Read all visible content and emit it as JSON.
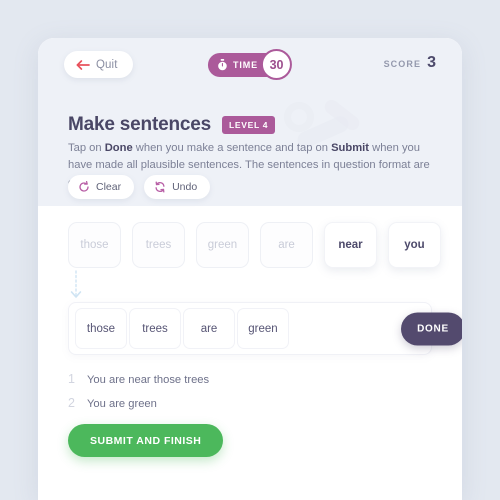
{
  "topbar": {
    "quit_label": "Quit",
    "quit_icon": "arrow-left-icon",
    "time_label": "TIME",
    "time_value": "30",
    "time_icon": "stopwatch-icon",
    "score_label": "SCORE",
    "score_value": "3"
  },
  "header": {
    "title": "Make sentences",
    "level_badge": "LEVEL 4",
    "instructions_line1_a": "Tap on ",
    "instructions_bold1": "Done",
    "instructions_line1_b": " when you make a sentence and tap on ",
    "instructions_bold2": "Submit",
    "instructions_line1_c": " when you have made all plausible sentences. The sentences in question format are excluded."
  },
  "actions": {
    "clear_label": "Clear",
    "clear_icon": "refresh-circle-icon",
    "undo_label": "Undo",
    "undo_icon": "undo-arrows-icon"
  },
  "word_bank": [
    {
      "word": "those",
      "state": "used"
    },
    {
      "word": "trees",
      "state": "used"
    },
    {
      "word": "green",
      "state": "used"
    },
    {
      "word": "are",
      "state": "used"
    },
    {
      "word": "near",
      "state": "active"
    },
    {
      "word": "you",
      "state": "active"
    }
  ],
  "answer_row": {
    "tiles": [
      "those",
      "trees",
      "are",
      "green"
    ],
    "done_label": "DONE"
  },
  "sentences": [
    {
      "num": "1",
      "text": "You are near those trees"
    },
    {
      "num": "2",
      "text": "You are green"
    }
  ],
  "submit": {
    "label": "SUBMIT AND FINISH"
  },
  "colors": {
    "page_background": "#e3e8f0",
    "card_background": "#ffffff",
    "header_band": "#eef1f7",
    "accent_purple": "#ab5a9a",
    "dark_purple": "#534a6e",
    "title_text": "#4a4766",
    "body_text": "#7c8096",
    "submit_green": "#4cb85c",
    "quit_arrow_red": "#e8525c"
  }
}
